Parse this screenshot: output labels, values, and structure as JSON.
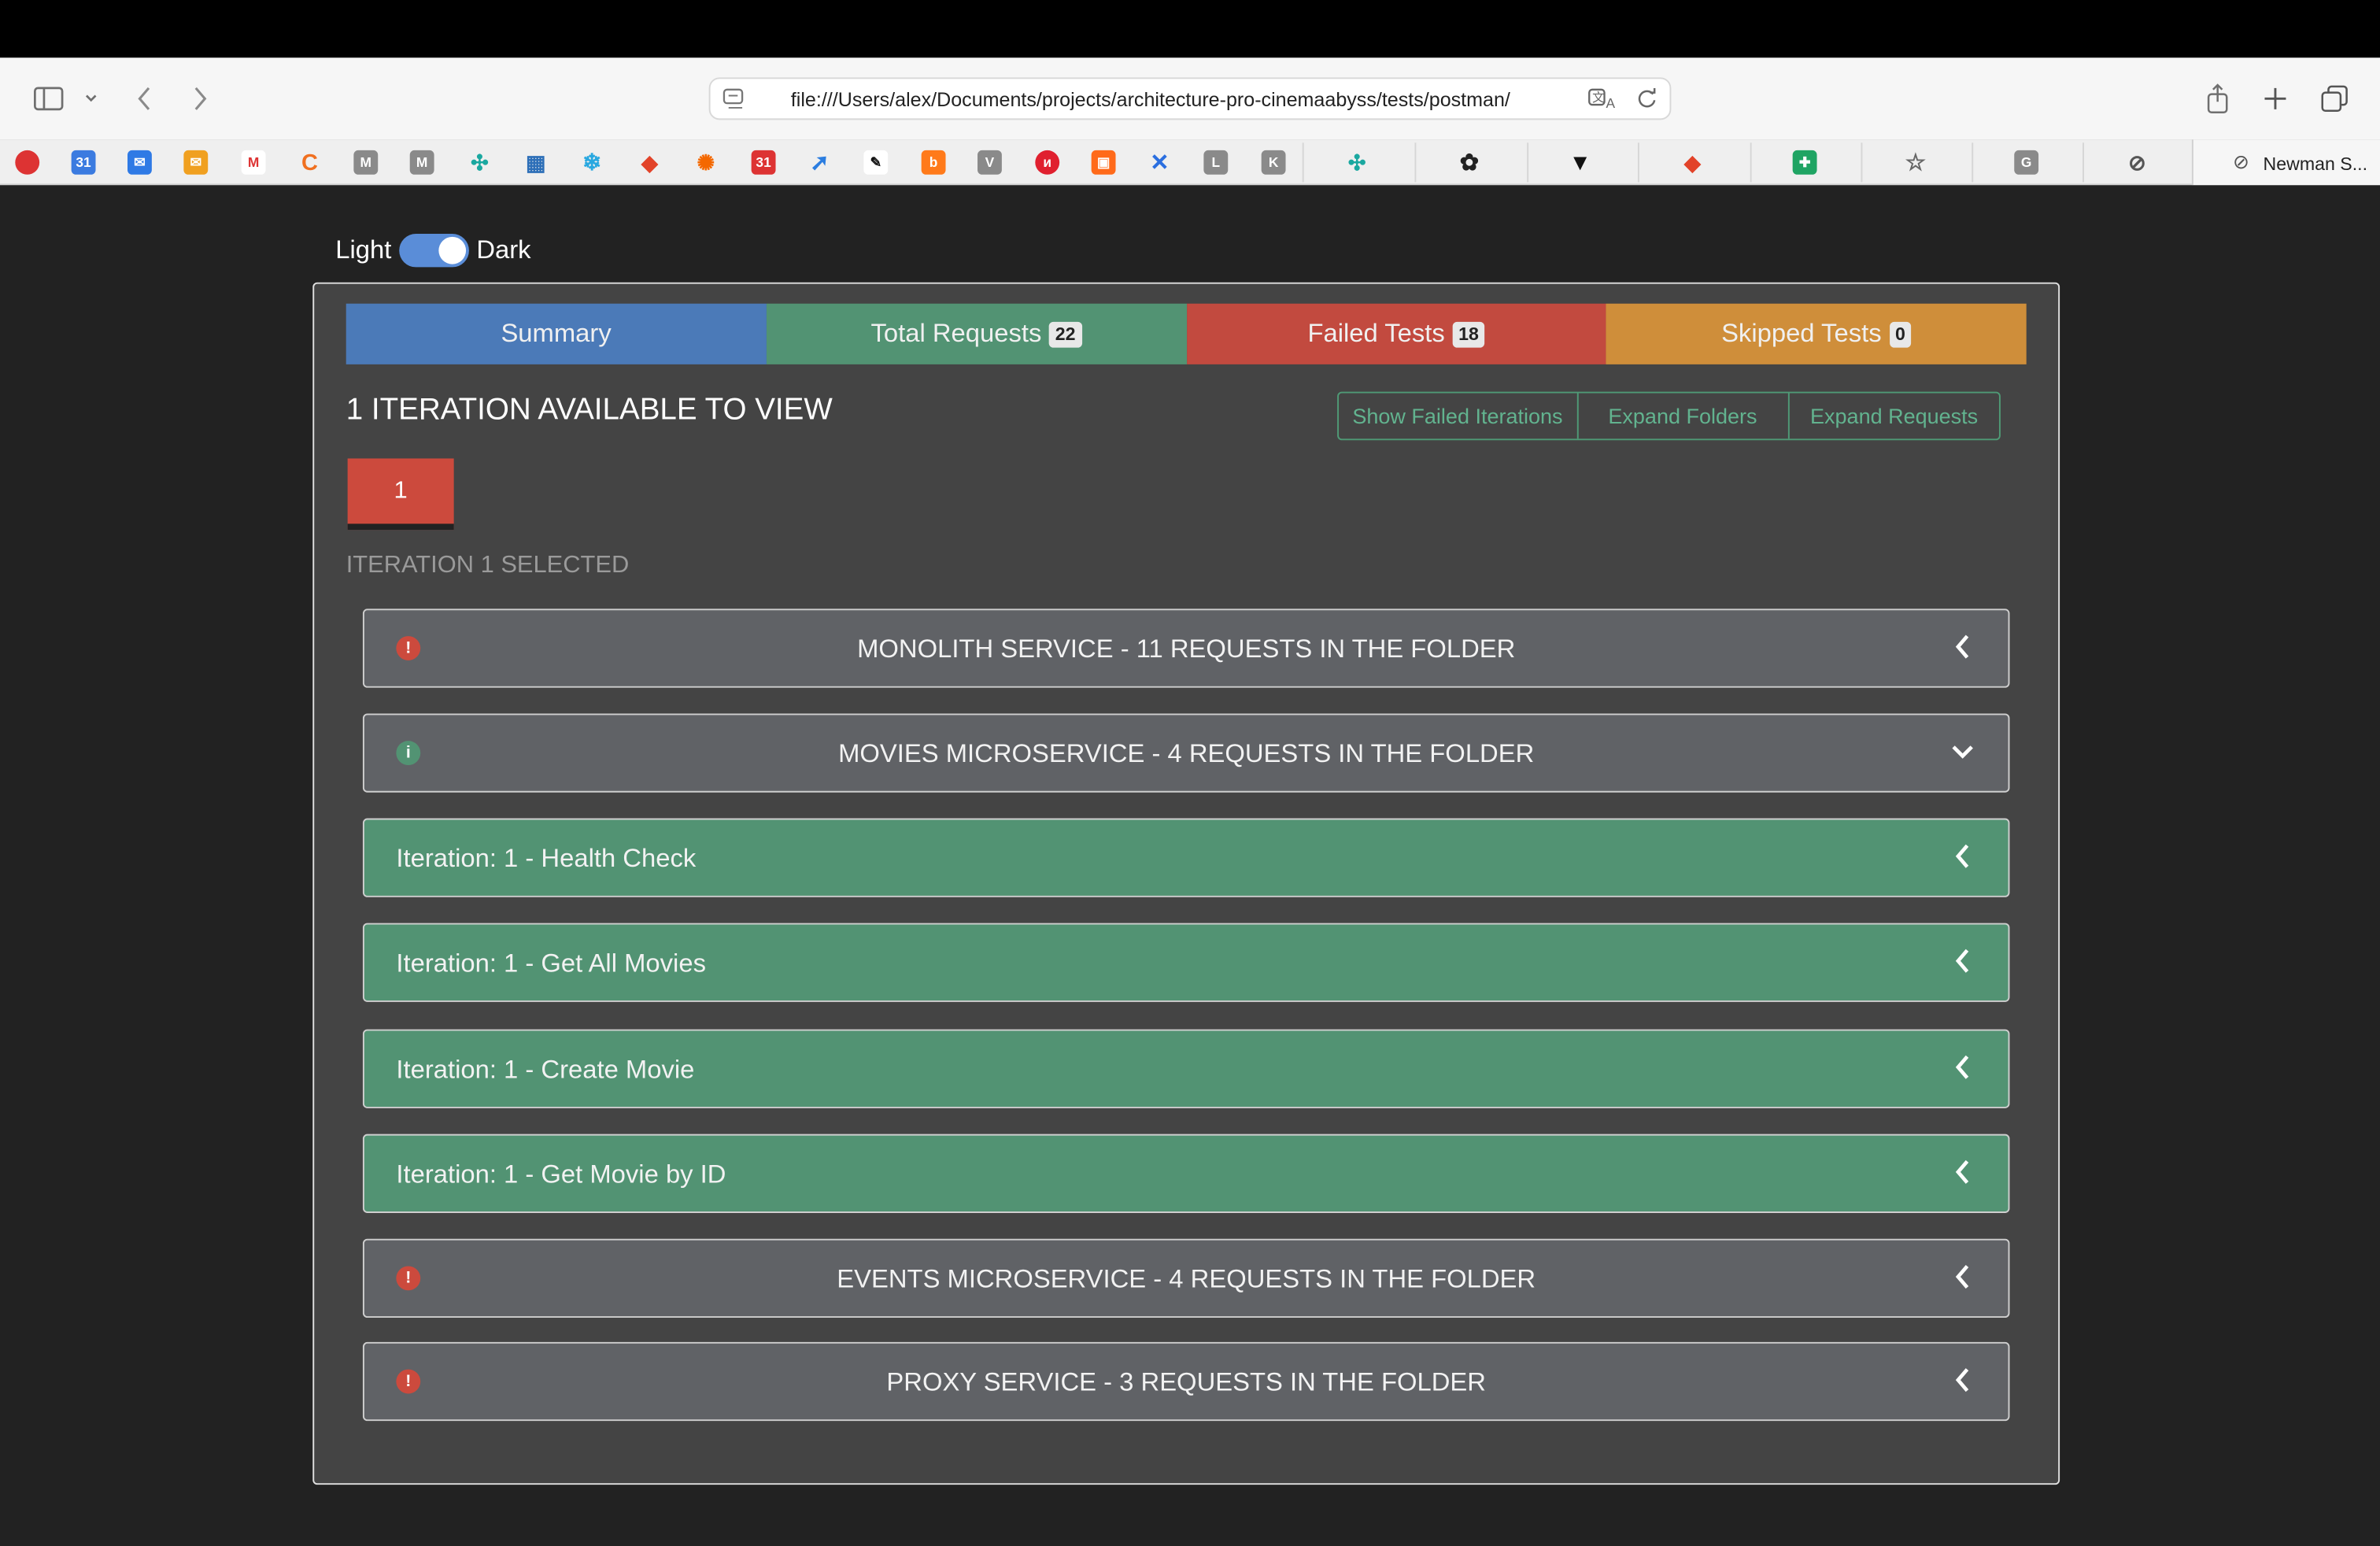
{
  "browser": {
    "url": "file:///Users/alex/Documents/projects/architecture-pro-cinemaabyss/tests/postman/",
    "active_tab_title": "Newman S..."
  },
  "theme_toggle": {
    "light_label": "Light",
    "dark_label": "Dark",
    "state": "dark"
  },
  "tabs": [
    {
      "label": "Summary",
      "badge": null,
      "color": "#4b7ab8"
    },
    {
      "label": "Total Requests",
      "badge": "22",
      "color": "#529373"
    },
    {
      "label": "Failed Tests",
      "badge": "18",
      "color": "#c24a3f"
    },
    {
      "label": "Skipped Tests",
      "badge": "0",
      "color": "#cf8e3a"
    }
  ],
  "heading": "1 ITERATION AVAILABLE TO VIEW",
  "actions": {
    "show_failed": "Show Failed Iterations",
    "expand_folders": "Expand Folders",
    "expand_requests": "Expand Requests"
  },
  "iteration_button": "1",
  "selected_label": "ITERATION 1 SELECTED",
  "panels": [
    {
      "title": "MONOLITH SERVICE - 11 REQUESTS IN THE FOLDER",
      "type": "folder",
      "status": "fail",
      "expanded": false
    },
    {
      "title": "MOVIES MICROSERVICE - 4 REQUESTS IN THE FOLDER",
      "type": "folder",
      "status": "pass",
      "expanded": true
    },
    {
      "title": "Iteration: 1 - Health Check",
      "type": "request",
      "status": "pass",
      "expanded": false
    },
    {
      "title": "Iteration: 1 - Get All Movies",
      "type": "request",
      "status": "pass",
      "expanded": false
    },
    {
      "title": "Iteration: 1 - Create Movie",
      "type": "request",
      "status": "pass",
      "expanded": false
    },
    {
      "title": "Iteration: 1 - Get Movie by ID",
      "type": "request",
      "status": "pass",
      "expanded": false
    },
    {
      "title": "EVENTS MICROSERVICE - 4 REQUESTS IN THE FOLDER",
      "type": "folder",
      "status": "fail",
      "expanded": false
    },
    {
      "title": "PROXY SERVICE - 3 REQUESTS IN THE FOLDER",
      "type": "folder",
      "status": "fail",
      "expanded": false
    }
  ],
  "colors": {
    "fail": "#cc4a3d",
    "pass": "#529373",
    "accent": "#4b7ab8"
  }
}
